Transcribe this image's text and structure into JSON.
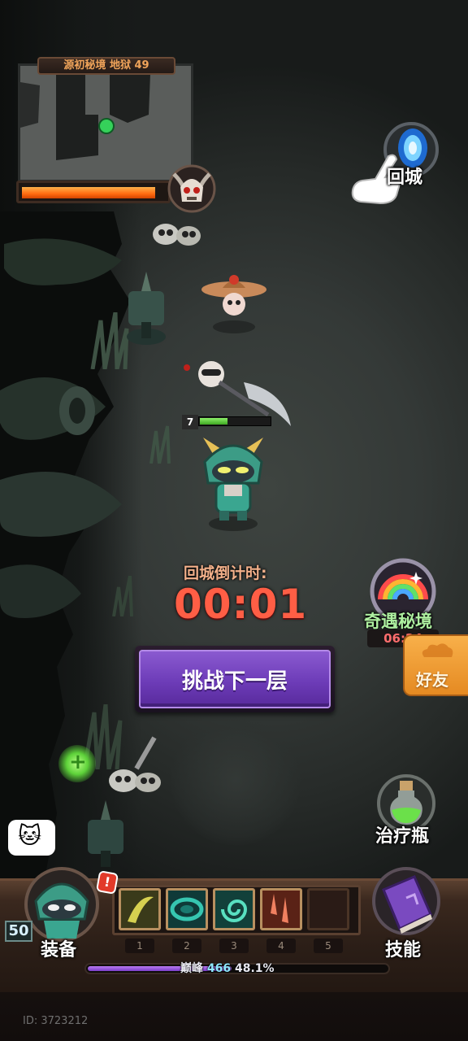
{
  "minimap": {
    "title": "源初秘境 地狱 49",
    "boss_hp_fraction": 0.93
  },
  "buttons": {
    "return_city": "回城",
    "secret_realm": "奇遇秘境",
    "secret_realm_timer": "06:24",
    "friends": "好友",
    "potion": "治疗瓶",
    "equipment": "装备",
    "skills": "技能",
    "challenge_next": "挑战下一层"
  },
  "countdown": {
    "label": "回城倒计时:",
    "value": "00:01"
  },
  "player": {
    "level_tag": "7",
    "hp_fraction": 0.4,
    "account_level": "50",
    "alert": "!"
  },
  "skill_slots": [
    {
      "num": "1",
      "icon": "crescent-slash-icon",
      "color": "#c9c24a"
    },
    {
      "num": "2",
      "icon": "tornado-icon",
      "color": "#2fb7a4"
    },
    {
      "num": "3",
      "icon": "swirl-icon",
      "color": "#3fd0b0"
    },
    {
      "num": "4",
      "icon": "blade-rain-icon",
      "color": "#e0603c"
    },
    {
      "num": "5",
      "icon": "",
      "color": ""
    }
  ],
  "peak": {
    "label": "巅峰",
    "level": "466",
    "percent": "48.1%",
    "fraction": 0.481
  },
  "chat_emoji": "🐱",
  "id_text": "ID: 3723212"
}
